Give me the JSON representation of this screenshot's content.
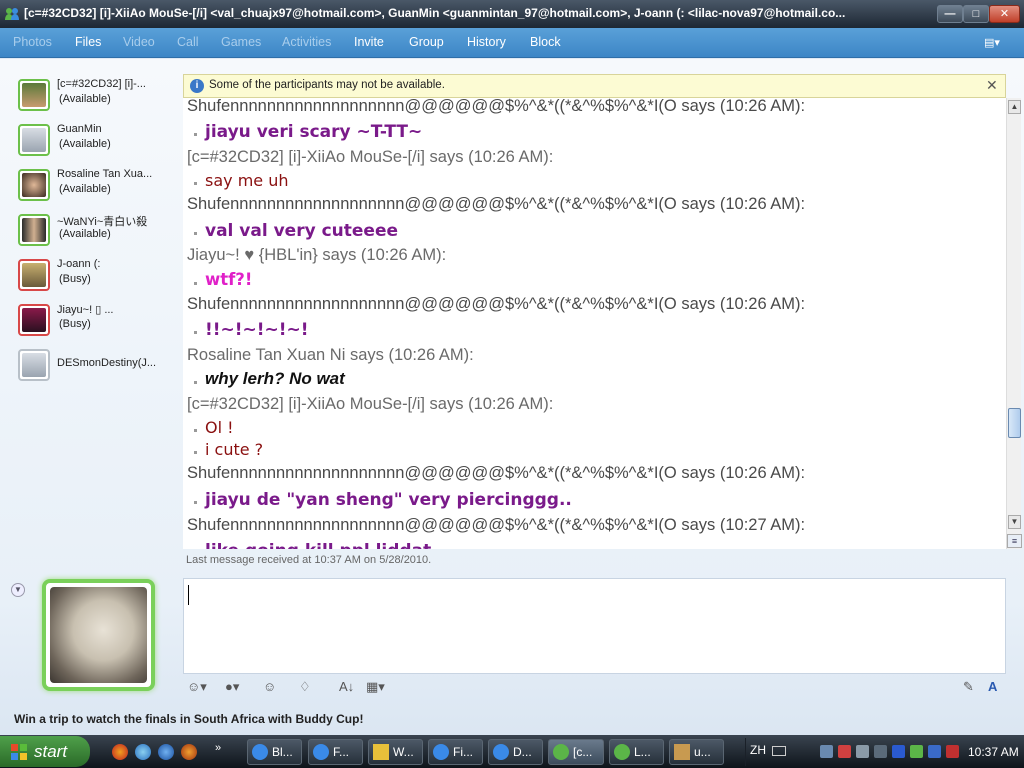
{
  "window": {
    "title": "[c=#32CD32] [i]-XiiAo MouSe-[/i] <val_chuajx97@hotmail.com>, GuanMin <guanmintan_97@hotmail.com>, J-oann (: <lilac-nova97@hotmail.co..."
  },
  "menu": {
    "items": [
      {
        "label": "Photos",
        "enabled": false
      },
      {
        "label": "Files",
        "enabled": true
      },
      {
        "label": "Video",
        "enabled": false
      },
      {
        "label": "Call",
        "enabled": false
      },
      {
        "label": "Games",
        "enabled": false
      },
      {
        "label": "Activities",
        "enabled": false
      },
      {
        "label": "Invite",
        "enabled": true
      },
      {
        "label": "Group",
        "enabled": true
      },
      {
        "label": "History",
        "enabled": true
      },
      {
        "label": "Block",
        "enabled": true
      }
    ]
  },
  "participants": [
    {
      "name": "[c=#32CD32] [i]-...",
      "status": "(Available)",
      "state": "available"
    },
    {
      "name": "GuanMin",
      "status": "(Available)",
      "state": "available"
    },
    {
      "name": "Rosaline Tan Xua...",
      "status": "(Available)",
      "state": "available"
    },
    {
      "name": "~WaNYi~青白い殺",
      "status": "(Available)",
      "state": "available"
    },
    {
      "name": "J-oann (:",
      "status": "(Busy)",
      "state": "busy"
    },
    {
      "name": "Jiayu~! ▯           ...",
      "status": "(Busy)",
      "state": "busy"
    },
    {
      "name": "DESmonDestiny(J...",
      "status": "",
      "state": "offline"
    }
  ],
  "infobar": {
    "message": "Some of the participants may not be available."
  },
  "chat": [
    {
      "type": "says",
      "text": "Shufennnnnnnnnnnnnnnnnnn@@@@@@$%^&*((*&^%$%^&*I(O says (10:26 AM):"
    },
    {
      "type": "msg",
      "text": "jiayu veri scary ~T-TT~",
      "style": "purple"
    },
    {
      "type": "says",
      "text": "[c=#32CD32] [i]-XiiAo MouSe-[/i] says (10:26 AM):"
    },
    {
      "type": "msg",
      "text": "say me uh",
      "style": "dark"
    },
    {
      "type": "says",
      "text": "Shufennnnnnnnnnnnnnnnnnn@@@@@@$%^&*((*&^%$%^&*I(O says (10:26 AM):"
    },
    {
      "type": "msg",
      "text": "val val very cuteeee",
      "style": "purple"
    },
    {
      "type": "says",
      "text": "Jiayu~! ♥                  {HBL'in} says (10:26 AM):"
    },
    {
      "type": "msg",
      "text": "wtf?!",
      "style": "magenta"
    },
    {
      "type": "says",
      "text": "Shufennnnnnnnnnnnnnnnnnn@@@@@@$%^&*((*&^%$%^&*I(O says (10:26 AM):"
    },
    {
      "type": "msg",
      "text": "!!~!~!~!~!",
      "style": "purple"
    },
    {
      "type": "says",
      "text": "Rosaline Tan Xuan Ni says (10:26 AM):"
    },
    {
      "type": "msg",
      "text": "why lerh? No wat",
      "style": "black"
    },
    {
      "type": "says",
      "text": "[c=#32CD32] [i]-XiiAo MouSe-[/i] says (10:26 AM):"
    },
    {
      "type": "msg",
      "text": "Ol !",
      "style": "dark"
    },
    {
      "type": "msg",
      "text": "i cute ?",
      "style": "dark"
    },
    {
      "type": "says",
      "text": "Shufennnnnnnnnnnnnnnnnnn@@@@@@$%^&*((*&^%$%^&*I(O says (10:26 AM):"
    },
    {
      "type": "msg",
      "text": "jiayu de \"yan sheng\" very piercinggg..",
      "style": "purple"
    },
    {
      "type": "says",
      "text": "Shufennnnnnnnnnnnnnnnnnn@@@@@@$%^&*((*&^%$%^&*I(O says (10:27 AM):"
    },
    {
      "type": "msg",
      "text": "like going kill ppl liddat",
      "style": "purple"
    }
  ],
  "last_message": "Last message received at 10:37 AM on 5/28/2010.",
  "promo": "Win a trip to watch the finals in South Africa with Buddy Cup!",
  "taskbar": {
    "start_label": "start",
    "buttons": [
      {
        "label": "Bl...",
        "active": false
      },
      {
        "label": "F...",
        "active": false
      },
      {
        "label": "W...",
        "active": false
      },
      {
        "label": "Fi...",
        "active": false
      },
      {
        "label": "D...",
        "active": false
      },
      {
        "label": "[c...",
        "active": true
      },
      {
        "label": "L...",
        "active": false
      },
      {
        "label": "u...",
        "active": false
      }
    ],
    "language": "ZH",
    "clock": "10:37 AM"
  }
}
